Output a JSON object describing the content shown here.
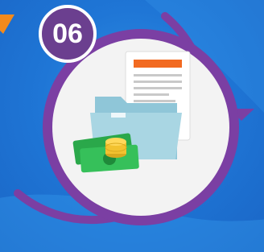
{
  "badge": {
    "number": "06"
  },
  "colors": {
    "background": "#1f76d6",
    "ring": "#7b3fa3",
    "badge": "#6b3f8f",
    "inner_circle": "#f3f3f3",
    "folder": "#a9d6e3",
    "doc_header": "#f26a21",
    "cash": "#2aa84a",
    "coin": "#f2c230",
    "arrow": "#f28a1c"
  },
  "icons": [
    "badge-06",
    "folder-document-icon",
    "cash-icon",
    "coin-stack-icon",
    "circular-arrow-icon"
  ]
}
